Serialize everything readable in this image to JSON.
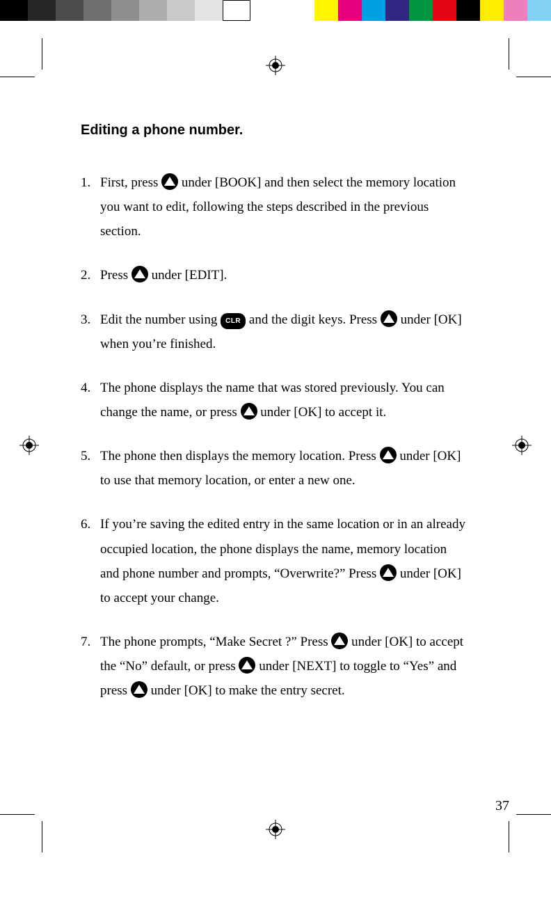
{
  "colourBars": {
    "left": [
      "#000000",
      "#272727",
      "#4d4d4d",
      "#6f6f6f",
      "#8f8f8f",
      "#adadad",
      "#c9c9c9",
      "#e4e4e4",
      "#ffffff"
    ],
    "right": [
      "#fff600",
      "#e6007e",
      "#009fe3",
      "#312783",
      "#009640",
      "#e30613",
      "#000000",
      "#ffed00",
      "#ef7ebd",
      "#83d0f5"
    ]
  },
  "page": {
    "heading": "Editing a phone number.",
    "steps": [
      {
        "n": "1.",
        "a": "First, press ",
        "b": " under [BOOK] and then select the memory location you want to edit, following the steps described in the previous section."
      },
      {
        "n": "2.",
        "a": "Press ",
        "b": " under [EDIT]."
      },
      {
        "n": "3.",
        "a": "Edit the number using ",
        "b": " and the digit keys. Press ",
        "c": " under [OK] when you’re finished."
      },
      {
        "n": "4.",
        "a": "The phone displays the name that was stored previously. You can change the name, or press ",
        "b": " under [OK] to accept it."
      },
      {
        "n": "5.",
        "a": "The phone then displays the memory location. Press ",
        "b": " under [OK] to use that memory location, or enter a new one."
      },
      {
        "n": "6.",
        "a": "If you’re saving the edited entry in the same location or in an already occupied location, the phone displays the name, memory location and phone number and prompts, “Overwrite?” Press ",
        "b": " under [OK] to accept your change."
      },
      {
        "n": "7.",
        "a": "The phone prompts, “Make Secret ?” Press ",
        "b": " under [OK] to accept the “No” default, or press ",
        "c": " under [NEXT] to toggle to “Yes” and press ",
        "d": " under [OK] to make the entry secret."
      }
    ],
    "clrLabel": "CLR",
    "number": "37"
  }
}
